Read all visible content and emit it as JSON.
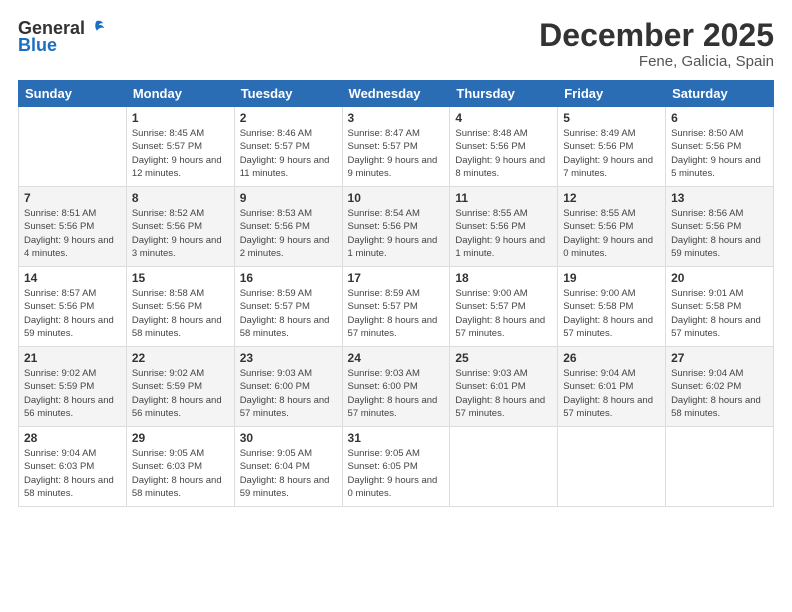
{
  "header": {
    "logo_general": "General",
    "logo_blue": "Blue",
    "month_title": "December 2025",
    "subtitle": "Fene, Galicia, Spain"
  },
  "weekdays": [
    "Sunday",
    "Monday",
    "Tuesday",
    "Wednesday",
    "Thursday",
    "Friday",
    "Saturday"
  ],
  "weeks": [
    [
      {
        "day": "",
        "sunrise": "",
        "sunset": "",
        "daylight": ""
      },
      {
        "day": "1",
        "sunrise": "Sunrise: 8:45 AM",
        "sunset": "Sunset: 5:57 PM",
        "daylight": "Daylight: 9 hours and 12 minutes."
      },
      {
        "day": "2",
        "sunrise": "Sunrise: 8:46 AM",
        "sunset": "Sunset: 5:57 PM",
        "daylight": "Daylight: 9 hours and 11 minutes."
      },
      {
        "day": "3",
        "sunrise": "Sunrise: 8:47 AM",
        "sunset": "Sunset: 5:57 PM",
        "daylight": "Daylight: 9 hours and 9 minutes."
      },
      {
        "day": "4",
        "sunrise": "Sunrise: 8:48 AM",
        "sunset": "Sunset: 5:56 PM",
        "daylight": "Daylight: 9 hours and 8 minutes."
      },
      {
        "day": "5",
        "sunrise": "Sunrise: 8:49 AM",
        "sunset": "Sunset: 5:56 PM",
        "daylight": "Daylight: 9 hours and 7 minutes."
      },
      {
        "day": "6",
        "sunrise": "Sunrise: 8:50 AM",
        "sunset": "Sunset: 5:56 PM",
        "daylight": "Daylight: 9 hours and 5 minutes."
      }
    ],
    [
      {
        "day": "7",
        "sunrise": "Sunrise: 8:51 AM",
        "sunset": "Sunset: 5:56 PM",
        "daylight": "Daylight: 9 hours and 4 minutes."
      },
      {
        "day": "8",
        "sunrise": "Sunrise: 8:52 AM",
        "sunset": "Sunset: 5:56 PM",
        "daylight": "Daylight: 9 hours and 3 minutes."
      },
      {
        "day": "9",
        "sunrise": "Sunrise: 8:53 AM",
        "sunset": "Sunset: 5:56 PM",
        "daylight": "Daylight: 9 hours and 2 minutes."
      },
      {
        "day": "10",
        "sunrise": "Sunrise: 8:54 AM",
        "sunset": "Sunset: 5:56 PM",
        "daylight": "Daylight: 9 hours and 1 minute."
      },
      {
        "day": "11",
        "sunrise": "Sunrise: 8:55 AM",
        "sunset": "Sunset: 5:56 PM",
        "daylight": "Daylight: 9 hours and 1 minute."
      },
      {
        "day": "12",
        "sunrise": "Sunrise: 8:55 AM",
        "sunset": "Sunset: 5:56 PM",
        "daylight": "Daylight: 9 hours and 0 minutes."
      },
      {
        "day": "13",
        "sunrise": "Sunrise: 8:56 AM",
        "sunset": "Sunset: 5:56 PM",
        "daylight": "Daylight: 8 hours and 59 minutes."
      }
    ],
    [
      {
        "day": "14",
        "sunrise": "Sunrise: 8:57 AM",
        "sunset": "Sunset: 5:56 PM",
        "daylight": "Daylight: 8 hours and 59 minutes."
      },
      {
        "day": "15",
        "sunrise": "Sunrise: 8:58 AM",
        "sunset": "Sunset: 5:56 PM",
        "daylight": "Daylight: 8 hours and 58 minutes."
      },
      {
        "day": "16",
        "sunrise": "Sunrise: 8:59 AM",
        "sunset": "Sunset: 5:57 PM",
        "daylight": "Daylight: 8 hours and 58 minutes."
      },
      {
        "day": "17",
        "sunrise": "Sunrise: 8:59 AM",
        "sunset": "Sunset: 5:57 PM",
        "daylight": "Daylight: 8 hours and 57 minutes."
      },
      {
        "day": "18",
        "sunrise": "Sunrise: 9:00 AM",
        "sunset": "Sunset: 5:57 PM",
        "daylight": "Daylight: 8 hours and 57 minutes."
      },
      {
        "day": "19",
        "sunrise": "Sunrise: 9:00 AM",
        "sunset": "Sunset: 5:58 PM",
        "daylight": "Daylight: 8 hours and 57 minutes."
      },
      {
        "day": "20",
        "sunrise": "Sunrise: 9:01 AM",
        "sunset": "Sunset: 5:58 PM",
        "daylight": "Daylight: 8 hours and 57 minutes."
      }
    ],
    [
      {
        "day": "21",
        "sunrise": "Sunrise: 9:02 AM",
        "sunset": "Sunset: 5:59 PM",
        "daylight": "Daylight: 8 hours and 56 minutes."
      },
      {
        "day": "22",
        "sunrise": "Sunrise: 9:02 AM",
        "sunset": "Sunset: 5:59 PM",
        "daylight": "Daylight: 8 hours and 56 minutes."
      },
      {
        "day": "23",
        "sunrise": "Sunrise: 9:03 AM",
        "sunset": "Sunset: 6:00 PM",
        "daylight": "Daylight: 8 hours and 57 minutes."
      },
      {
        "day": "24",
        "sunrise": "Sunrise: 9:03 AM",
        "sunset": "Sunset: 6:00 PM",
        "daylight": "Daylight: 8 hours and 57 minutes."
      },
      {
        "day": "25",
        "sunrise": "Sunrise: 9:03 AM",
        "sunset": "Sunset: 6:01 PM",
        "daylight": "Daylight: 8 hours and 57 minutes."
      },
      {
        "day": "26",
        "sunrise": "Sunrise: 9:04 AM",
        "sunset": "Sunset: 6:01 PM",
        "daylight": "Daylight: 8 hours and 57 minutes."
      },
      {
        "day": "27",
        "sunrise": "Sunrise: 9:04 AM",
        "sunset": "Sunset: 6:02 PM",
        "daylight": "Daylight: 8 hours and 58 minutes."
      }
    ],
    [
      {
        "day": "28",
        "sunrise": "Sunrise: 9:04 AM",
        "sunset": "Sunset: 6:03 PM",
        "daylight": "Daylight: 8 hours and 58 minutes."
      },
      {
        "day": "29",
        "sunrise": "Sunrise: 9:05 AM",
        "sunset": "Sunset: 6:03 PM",
        "daylight": "Daylight: 8 hours and 58 minutes."
      },
      {
        "day": "30",
        "sunrise": "Sunrise: 9:05 AM",
        "sunset": "Sunset: 6:04 PM",
        "daylight": "Daylight: 8 hours and 59 minutes."
      },
      {
        "day": "31",
        "sunrise": "Sunrise: 9:05 AM",
        "sunset": "Sunset: 6:05 PM",
        "daylight": "Daylight: 9 hours and 0 minutes."
      },
      {
        "day": "",
        "sunrise": "",
        "sunset": "",
        "daylight": ""
      },
      {
        "day": "",
        "sunrise": "",
        "sunset": "",
        "daylight": ""
      },
      {
        "day": "",
        "sunrise": "",
        "sunset": "",
        "daylight": ""
      }
    ]
  ]
}
